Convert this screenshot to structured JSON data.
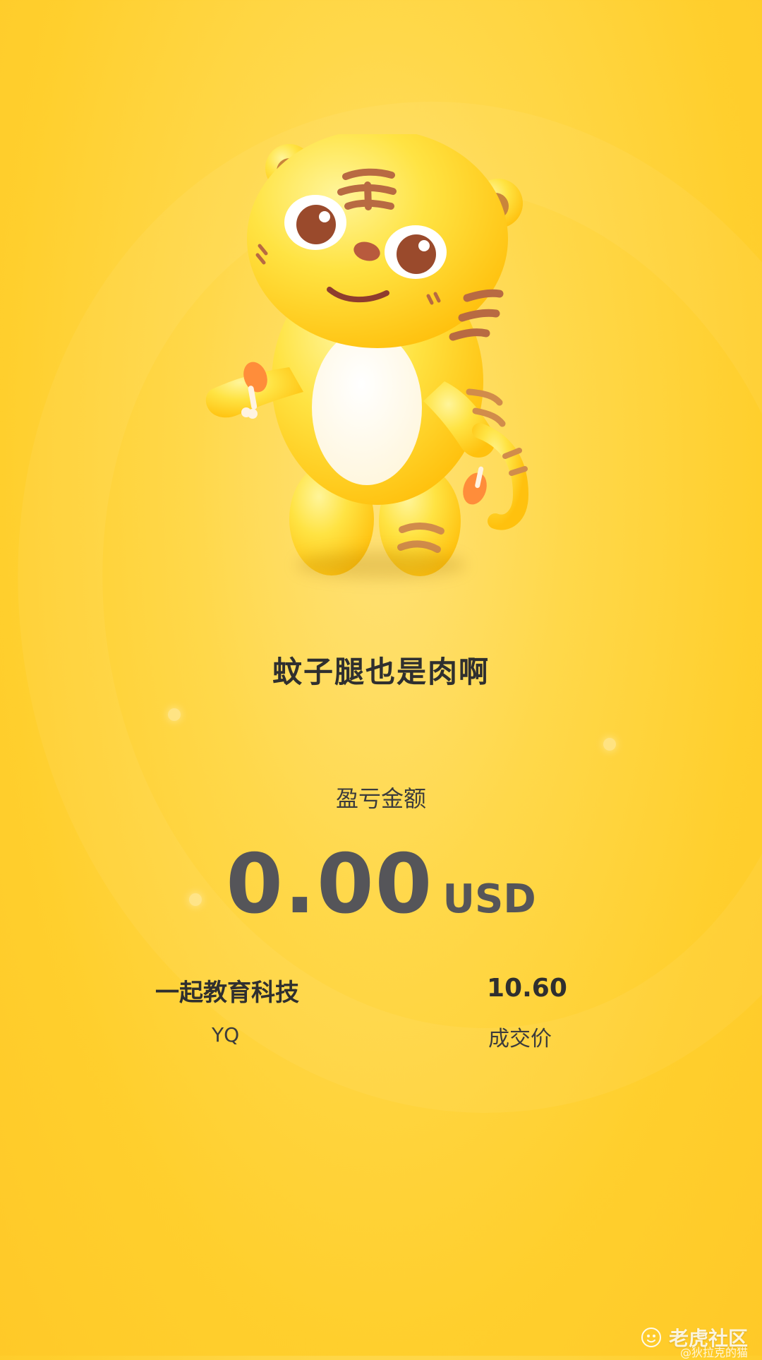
{
  "title": "蚊子腿也是肉啊",
  "pnl": {
    "label": "盈亏金额",
    "amount": "0.00",
    "unit": "USD"
  },
  "stock": {
    "name": "一起教育科技",
    "ticker": "YQ"
  },
  "trade": {
    "price": "10.60",
    "label": "成交价"
  },
  "watermark": {
    "brand": "老虎社区",
    "user": "@狄拉克的猫"
  },
  "colors": {
    "background": "#ffd33a",
    "text_dark": "#2f2f2f",
    "pnl_text": "#555559"
  }
}
